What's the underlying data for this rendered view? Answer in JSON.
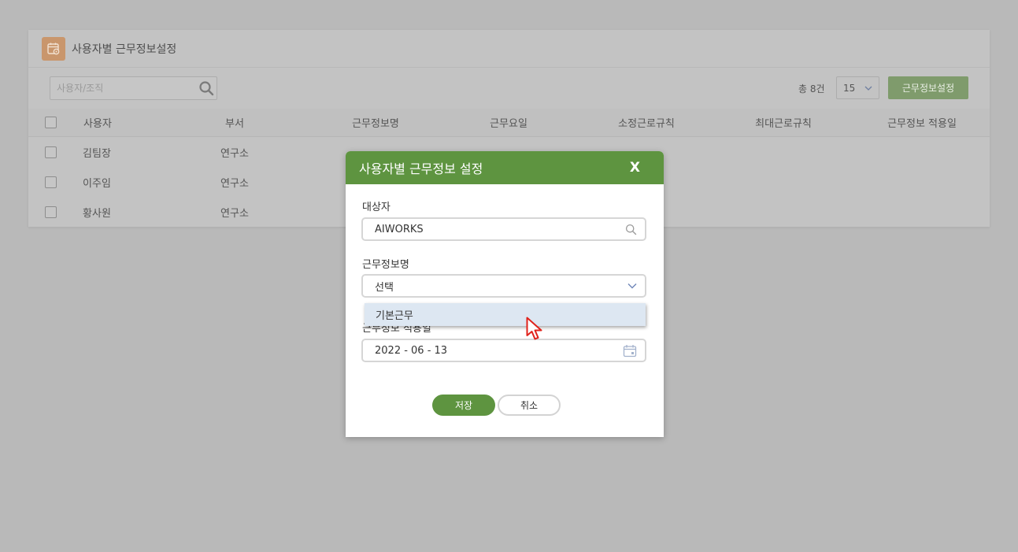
{
  "page": {
    "title": "사용자별 근무정보설정",
    "search_placeholder": "사용자/조직",
    "total_count": "총 8건",
    "page_size": "15",
    "set_button": "근무정보설정",
    "columns": [
      "사용자",
      "부서",
      "근무정보명",
      "근무요일",
      "소정근로규칙",
      "최대근로규칙",
      "근무정보 적용일"
    ],
    "rows": [
      {
        "user": "김팀장",
        "dept": "연구소"
      },
      {
        "user": "이주임",
        "dept": "연구소"
      },
      {
        "user": "황사원",
        "dept": "연구소"
      }
    ]
  },
  "modal": {
    "title": "사용자별 근무정보 설정",
    "close": "X",
    "target_label": "대상자",
    "target_value": "AIWORKS",
    "workinfo_label": "근무정보명",
    "workinfo_value": "선택",
    "workinfo_options": [
      "기본근무"
    ],
    "date_label": "근무정보 적용일",
    "date_value": "2022 - 06 - 13",
    "save": "저장",
    "cancel": "취소"
  },
  "colors": {
    "modal_header": "#5e9440",
    "option_highlight": "#dde7f2",
    "overlay_bg": "#b9b9b9"
  }
}
